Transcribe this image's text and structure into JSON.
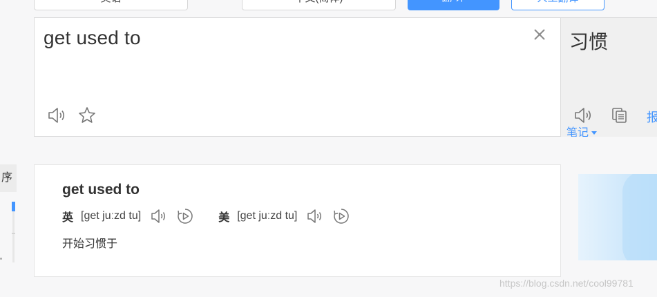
{
  "top_bar": {
    "source_lang": "英语",
    "swap_icon": "swap-arrows-icon",
    "target_lang": "中文(简体)",
    "translate_label": "翻 译",
    "human_label": "人工翻译"
  },
  "input": {
    "text": "get used to",
    "icons": [
      "close-icon",
      "speaker-icon",
      "star-icon"
    ]
  },
  "output": {
    "text": "习惯",
    "report_label": "报",
    "notes_label": "笔记",
    "icons": [
      "speaker-icon",
      "copy-icon"
    ]
  },
  "side": {
    "tab_label": "序"
  },
  "dictionary": {
    "word": "get used to",
    "phonetics": [
      {
        "label": "英",
        "text": "[get juːzd tu]"
      },
      {
        "label": "美",
        "text": "[get juːzd tu]"
      }
    ],
    "meaning": "开始习惯于"
  },
  "watermark": "https://blog.csdn.net/cool99781",
  "colors": {
    "accent": "#4395ff",
    "background": "#f7f7f8",
    "panel": "#ffffff",
    "output_bg": "#f0f0f0"
  }
}
